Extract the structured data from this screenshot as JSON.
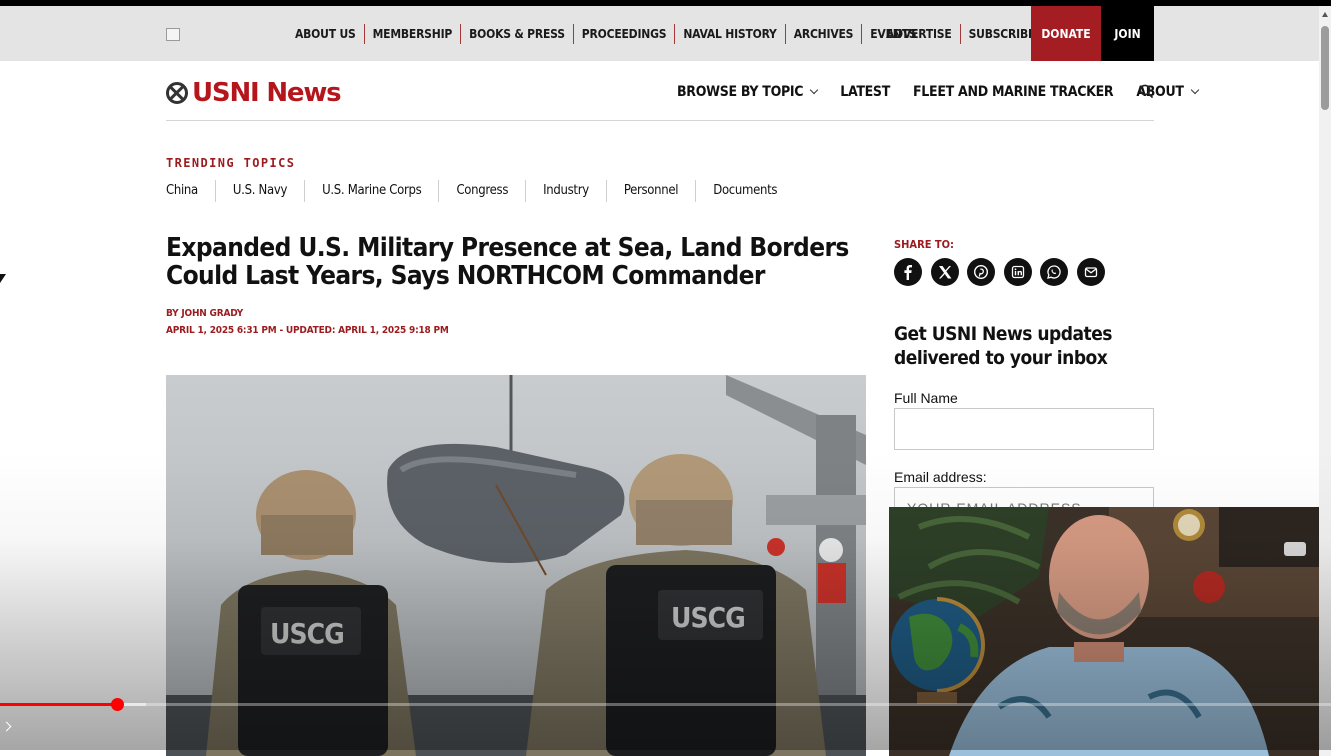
{
  "utility_nav": {
    "items": [
      "ABOUT US",
      "MEMBERSHIP",
      "BOOKS & PRESS",
      "PROCEEDINGS",
      "NAVAL HISTORY",
      "ARCHIVES",
      "EVENTS"
    ],
    "right_items": [
      "ADVERTISE",
      "SUBSCRIBE"
    ],
    "donate_label": "DONATE",
    "join_label": "JOIN"
  },
  "header": {
    "brand": "USNI News",
    "nav": [
      {
        "label": "BROWSE BY TOPIC",
        "dropdown": true
      },
      {
        "label": "LATEST",
        "dropdown": false
      },
      {
        "label": "FLEET AND MARINE TRACKER",
        "dropdown": false
      },
      {
        "label": "ABOUT",
        "dropdown": true
      }
    ],
    "search_icon": "search-icon"
  },
  "trending": {
    "label": "TRENDING TOPICS",
    "items": [
      "China",
      "U.S. Navy",
      "U.S. Marine Corps",
      "Congress",
      "Industry",
      "Personnel",
      "Documents"
    ]
  },
  "article": {
    "headline": "Expanded U.S. Military Presence at Sea, Land Borders Could Last Years, Says NORTHCOM Commander",
    "by_prefix": "BY",
    "author": "JOHN GRADY",
    "dateline": "APRIL 1, 2025 6:31 PM - UPDATED: APRIL 1, 2025 9:18 PM",
    "vest_label": "USCG"
  },
  "sidebar": {
    "share_label": "SHARE TO:",
    "share_icons": [
      "facebook-icon",
      "x-icon",
      "pinterest-icon",
      "linkedin-icon",
      "whatsapp-icon",
      "email-icon"
    ],
    "newsletter_title": "Get USNI News updates delivered to your inbox",
    "name_label": "Full Name",
    "name_value": "",
    "email_label": "Email address:",
    "email_placeholder": "YOUR EMAIL ADDRESS"
  },
  "player": {
    "progress": 0.088,
    "buffered": 0.11
  },
  "colors": {
    "brand_red": "#b5161c",
    "accent_red": "#9b1b1f",
    "donate_bg": "#a31d22",
    "join_bg": "#000000",
    "progress_red": "#ff0000"
  }
}
